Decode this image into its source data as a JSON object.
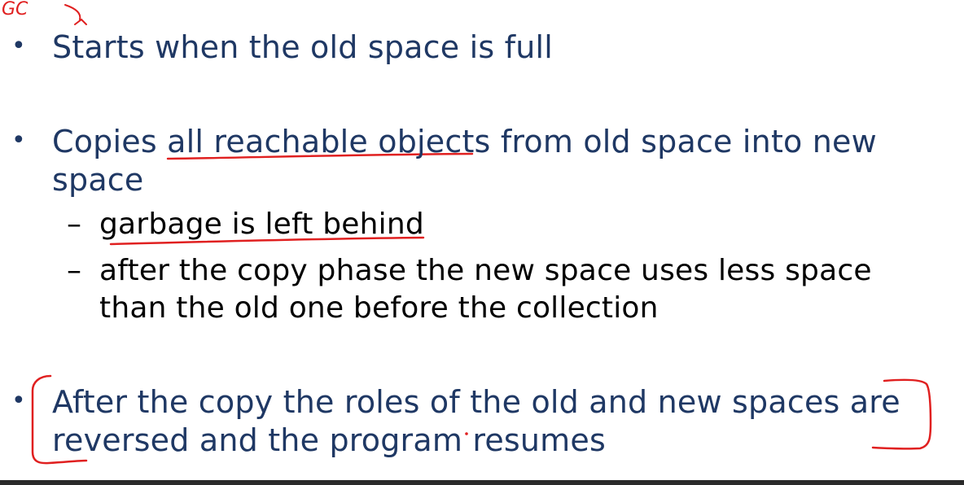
{
  "annotation": {
    "gc_label": "GC"
  },
  "bullets": [
    {
      "marker": "•",
      "line1": "Starts when the old space is full",
      "line2": ""
    },
    {
      "marker": "•",
      "line1": "Copies all reachable objects from old space into new",
      "line2": "space"
    },
    {
      "marker": "•",
      "line1": "After the copy the roles of the old and new spaces are",
      "line2": "reversed and the program resumes"
    }
  ],
  "subbullets": [
    {
      "marker": "–",
      "line1": "garbage is left behind",
      "line2": ""
    },
    {
      "marker": "–",
      "line1": "after the copy phase the new space uses less space",
      "line2": "than the old one before the collection"
    }
  ],
  "colors": {
    "main_text": "#1f3864",
    "sub_text": "#000000",
    "ink": "#e02020"
  }
}
